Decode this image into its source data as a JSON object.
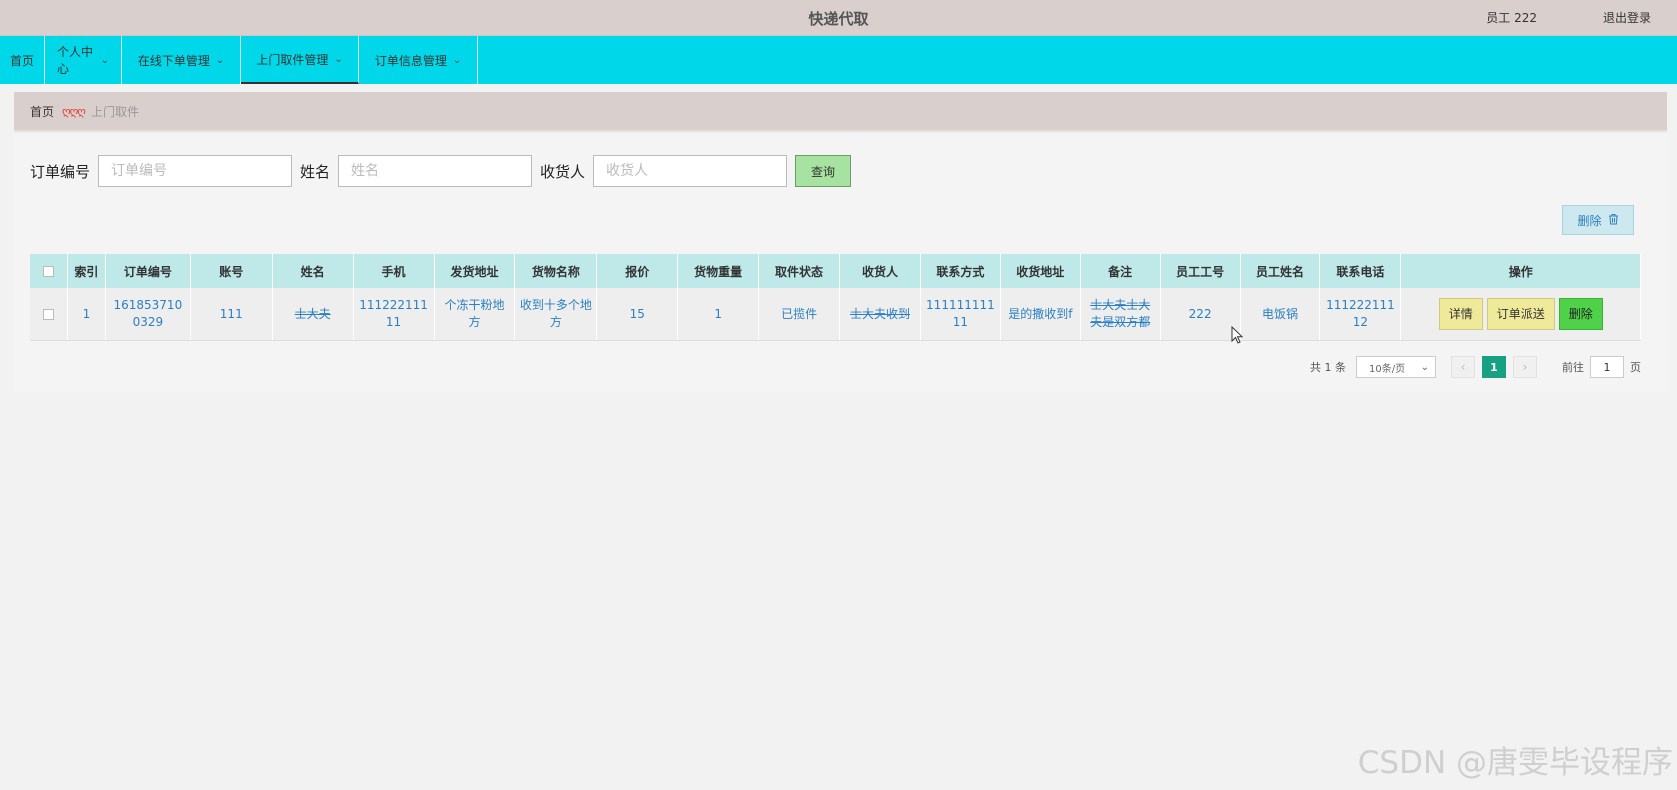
{
  "topbar": {
    "title": "快递代取",
    "user": "员工 222",
    "logout": "退出登录"
  },
  "nav": {
    "items": [
      {
        "label": "首页",
        "has_menu": false,
        "active": false
      },
      {
        "label": "个人中心",
        "has_menu": true,
        "active": false
      },
      {
        "label": "在线下单管理",
        "has_menu": true,
        "active": false
      },
      {
        "label": "上门取件管理",
        "has_menu": true,
        "active": true
      },
      {
        "label": "订单信息管理",
        "has_menu": true,
        "active": false
      }
    ],
    "chevron": "⌄"
  },
  "breadcrumb": {
    "home": "首页",
    "separator": "ღღღ",
    "current": "上门取件"
  },
  "search": {
    "order_no_label": "订单编号",
    "order_no_placeholder": "订单编号",
    "order_no_value": "",
    "name_label": "姓名",
    "name_placeholder": "姓名",
    "name_value": "",
    "receiver_label": "收货人",
    "receiver_placeholder": "收货人",
    "receiver_value": "",
    "query_button": "查询"
  },
  "toolbar": {
    "delete_label": "删除",
    "delete_icon": "trash-icon"
  },
  "table": {
    "headers": [
      "",
      "索引",
      "订单编号",
      "账号",
      "姓名",
      "手机",
      "发货地址",
      "货物名称",
      "报价",
      "货物重量",
      "取件状态",
      "收货人",
      "联系方式",
      "收货地址",
      "备注",
      "员工工号",
      "员工姓名",
      "联系电话",
      "操作"
    ],
    "rows": [
      {
        "index": "1",
        "order_no": "1618537100329",
        "account": "111",
        "name": "士大夫",
        "phone": "11122211111",
        "ship_address": "个冻干粉地方",
        "goods_name": "收到十多个地方",
        "quote": "15",
        "weight": "1",
        "status": "已揽件",
        "receiver": "士大夫收到",
        "contact": "11111111111",
        "receive_address": "是的撒收到f",
        "remark": "士大夫士大夫是双方都",
        "staff_no": "222",
        "staff_name": "电饭锅",
        "staff_phone": "11122211112",
        "actions": {
          "detail": "详情",
          "dispatch": "订单派送",
          "delete": "删除"
        }
      }
    ]
  },
  "pagination": {
    "total": "共 1 条",
    "page_size": "10条/页",
    "current_page": "1",
    "goto_label": "前往",
    "goto_value": "1",
    "page_unit": "页"
  },
  "watermark": "CSDN @唐雯毕设程序",
  "colors": {
    "topbar": "#d9cfcc",
    "navbar": "#00d8ea",
    "table_header": "#bfe9e9",
    "link_blue": "#2b7fc5",
    "query_green": "#a6e3a0",
    "action_yellow": "#efe99a",
    "delete_green": "#4fd24a",
    "page_active": "#17a082"
  }
}
